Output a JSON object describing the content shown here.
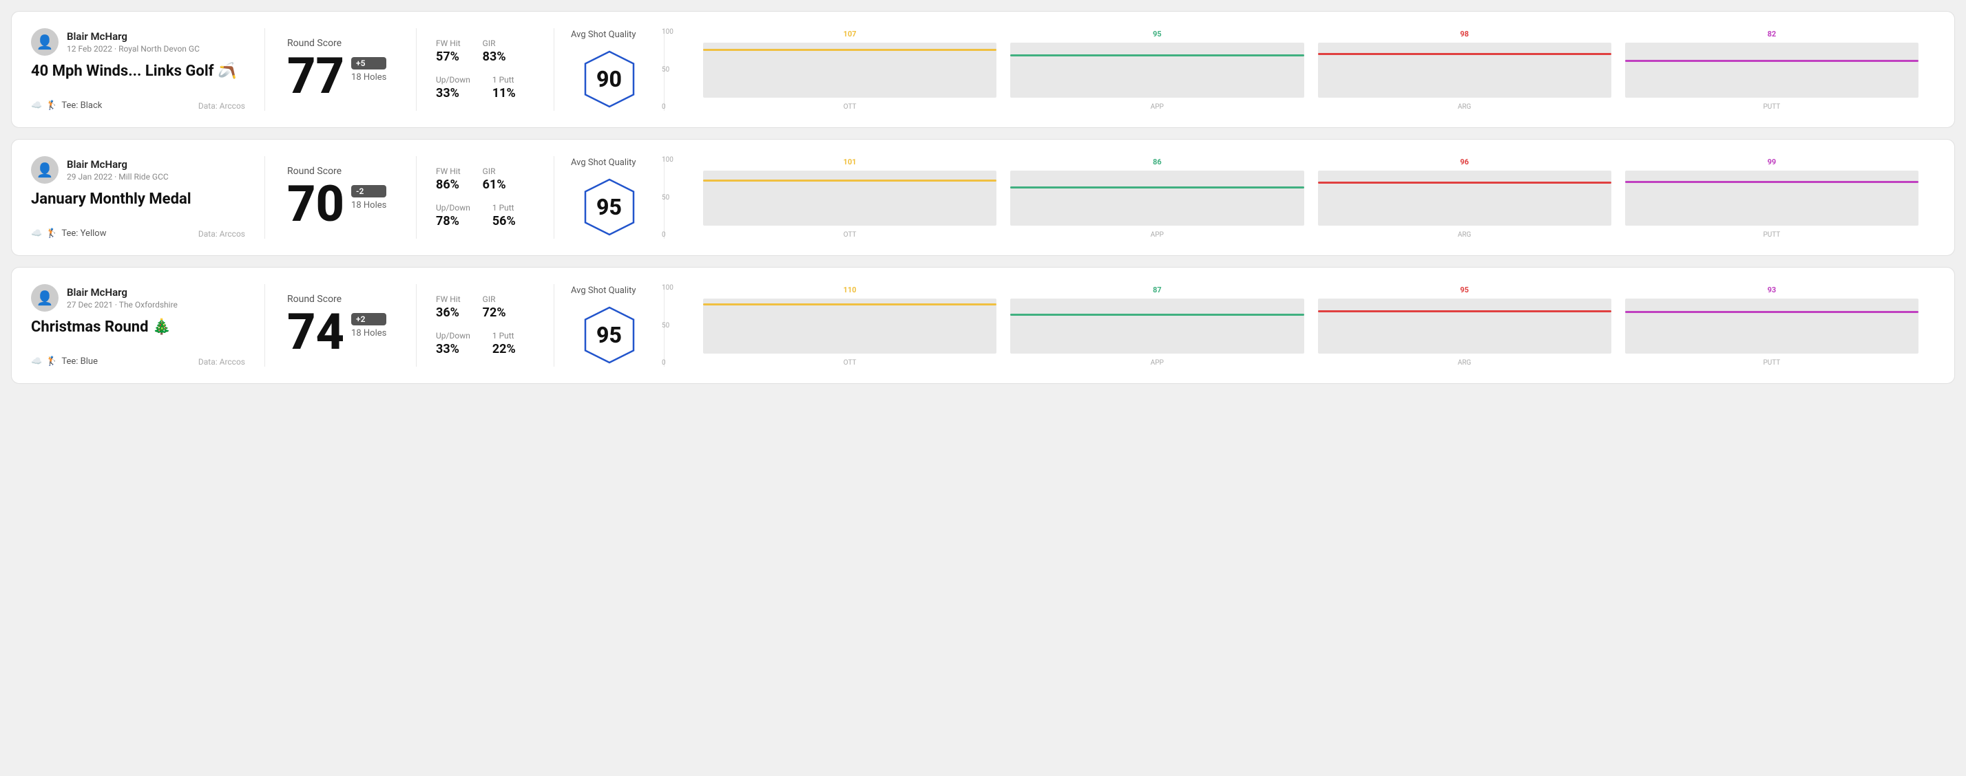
{
  "rounds": [
    {
      "id": "round1",
      "user": {
        "name": "Blair McHarg",
        "date_course": "12 Feb 2022 · Royal North Devon GC"
      },
      "title": "40 Mph Winds... Links Golf 🪃",
      "tee": "Black",
      "data_source": "Data: Arccos",
      "round_score_label": "Round Score",
      "score": "77",
      "badge": "+5",
      "holes": "18 Holes",
      "fw_hit_label": "FW Hit",
      "fw_hit_value": "57%",
      "gir_label": "GIR",
      "gir_value": "83%",
      "updown_label": "Up/Down",
      "updown_value": "33%",
      "oneputt_label": "1 Putt",
      "oneputt_value": "11%",
      "avg_label": "Avg Shot Quality",
      "avg_score": "90",
      "chart": {
        "cols": [
          {
            "label": "OTT",
            "top_value": "107",
            "top_color": "#f0c040",
            "bar_pct": 72,
            "line_pct": 85
          },
          {
            "label": "APP",
            "top_value": "95",
            "top_color": "#40b080",
            "bar_pct": 65,
            "line_pct": 75
          },
          {
            "label": "ARG",
            "top_value": "98",
            "top_color": "#e04040",
            "bar_pct": 68,
            "line_pct": 78
          },
          {
            "label": "PUTT",
            "top_value": "82",
            "top_color": "#c040c0",
            "bar_pct": 55,
            "line_pct": 65
          }
        ],
        "y_labels": [
          "100",
          "50",
          "0"
        ]
      }
    },
    {
      "id": "round2",
      "user": {
        "name": "Blair McHarg",
        "date_course": "29 Jan 2022 · Mill Ride GCC"
      },
      "title": "January Monthly Medal",
      "tee": "Yellow",
      "data_source": "Data: Arccos",
      "round_score_label": "Round Score",
      "score": "70",
      "badge": "-2",
      "holes": "18 Holes",
      "fw_hit_label": "FW Hit",
      "fw_hit_value": "86%",
      "gir_label": "GIR",
      "gir_value": "61%",
      "updown_label": "Up/Down",
      "updown_value": "78%",
      "oneputt_label": "1 Putt",
      "oneputt_value": "56%",
      "avg_label": "Avg Shot Quality",
      "avg_score": "95",
      "chart": {
        "cols": [
          {
            "label": "OTT",
            "top_value": "101",
            "top_color": "#f0c040",
            "bar_pct": 68,
            "line_pct": 80
          },
          {
            "label": "APP",
            "top_value": "86",
            "top_color": "#40b080",
            "bar_pct": 58,
            "line_pct": 68
          },
          {
            "label": "ARG",
            "top_value": "96",
            "top_color": "#e04040",
            "bar_pct": 65,
            "line_pct": 76
          },
          {
            "label": "PUTT",
            "top_value": "99",
            "top_color": "#c040c0",
            "bar_pct": 67,
            "line_pct": 78
          }
        ],
        "y_labels": [
          "100",
          "50",
          "0"
        ]
      }
    },
    {
      "id": "round3",
      "user": {
        "name": "Blair McHarg",
        "date_course": "27 Dec 2021 · The Oxfordshire"
      },
      "title": "Christmas Round 🎄",
      "tee": "Blue",
      "data_source": "Data: Arccos",
      "round_score_label": "Round Score",
      "score": "74",
      "badge": "+2",
      "holes": "18 Holes",
      "fw_hit_label": "FW Hit",
      "fw_hit_value": "36%",
      "gir_label": "GIR",
      "gir_value": "72%",
      "updown_label": "Up/Down",
      "updown_value": "33%",
      "oneputt_label": "1 Putt",
      "oneputt_value": "22%",
      "avg_label": "Avg Shot Quality",
      "avg_score": "95",
      "chart": {
        "cols": [
          {
            "label": "OTT",
            "top_value": "110",
            "top_color": "#f0c040",
            "bar_pct": 75,
            "line_pct": 87
          },
          {
            "label": "APP",
            "top_value": "87",
            "top_color": "#40b080",
            "bar_pct": 58,
            "line_pct": 69
          },
          {
            "label": "ARG",
            "top_value": "95",
            "top_color": "#e04040",
            "bar_pct": 64,
            "line_pct": 75
          },
          {
            "label": "PUTT",
            "top_value": "93",
            "top_color": "#c040c0",
            "bar_pct": 62,
            "line_pct": 74
          }
        ],
        "y_labels": [
          "100",
          "50",
          "0"
        ]
      }
    }
  ]
}
